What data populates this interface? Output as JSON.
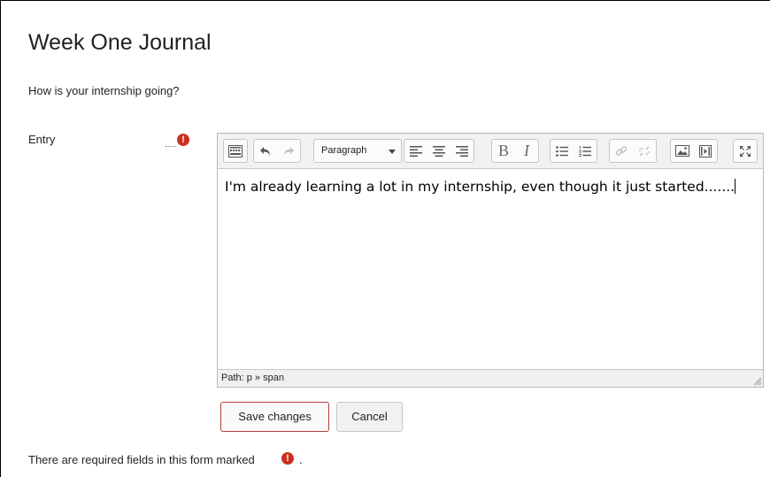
{
  "page": {
    "title": "Week One Journal",
    "question": "How is your internship going?"
  },
  "form": {
    "entry_label": "Entry",
    "required_icon": "exclamation-circle-icon",
    "editor": {
      "block_format": "Paragraph",
      "content": "I'm already learning a lot in my internship, even though it just started.......",
      "path": "Path: p » span",
      "toolbar_icons": [
        "toolbar-toggle-icon",
        "undo-icon",
        "redo-icon",
        "align-left-icon",
        "align-center-icon",
        "align-right-icon",
        "bold-icon",
        "italic-icon",
        "bullet-list-icon",
        "numbered-list-icon",
        "link-icon",
        "unlink-icon",
        "image-icon",
        "media-icon",
        "fullscreen-icon"
      ]
    },
    "save_label": "Save changes",
    "cancel_label": "Cancel",
    "required_note": "There are required fields in this form marked",
    "required_note_end": "."
  },
  "colors": {
    "required": "#ca3120",
    "save_border": "#b63d3d"
  }
}
